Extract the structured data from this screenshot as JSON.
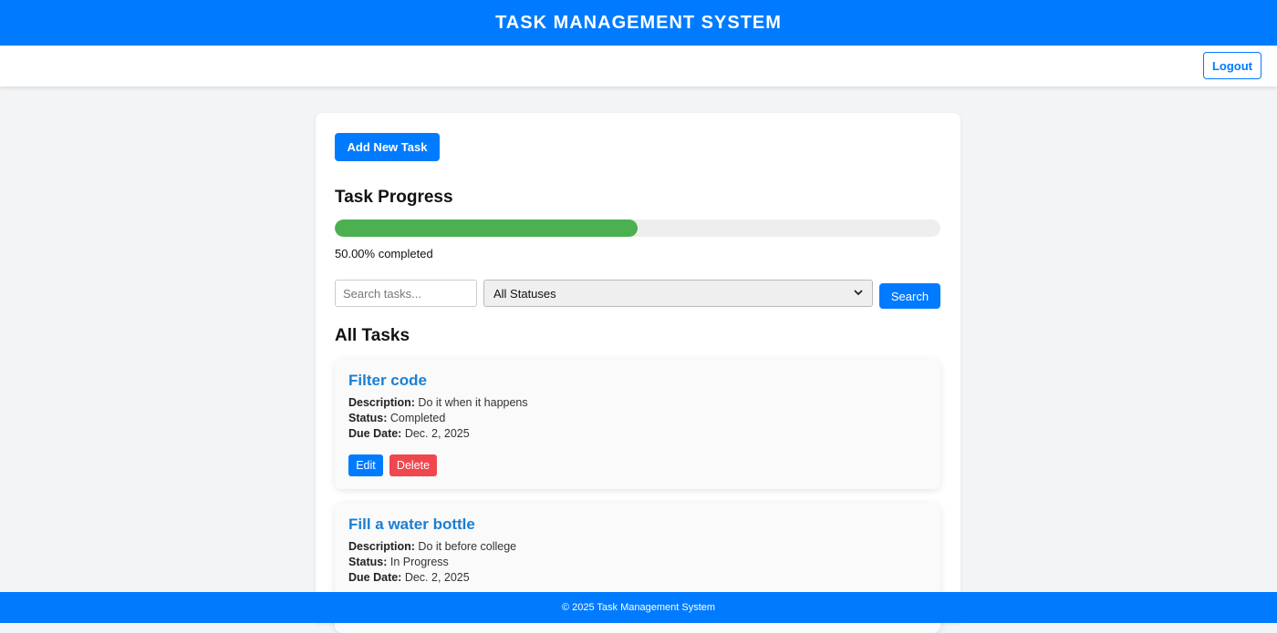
{
  "header": {
    "title": "TASK MANAGEMENT SYSTEM"
  },
  "nav": {
    "logout_label": "Logout"
  },
  "main": {
    "add_task_label": "Add New Task",
    "progress": {
      "title": "Task Progress",
      "fraction": 0.5,
      "text": "50.00% completed",
      "fill_color": "#4caf50"
    },
    "search": {
      "placeholder": "Search tasks...",
      "value": "",
      "status_selected": "All Statuses",
      "button_label": "Search"
    },
    "tasks_heading": "All Tasks",
    "tasks": [
      {
        "title": "Filter code",
        "description_label": "Description:",
        "description": "Do it when it happens",
        "status_label": "Status:",
        "status": "Completed",
        "due_label": "Due Date:",
        "due": "Dec. 2, 2025",
        "edit_label": "Edit",
        "delete_label": "Delete"
      },
      {
        "title": "Fill a water bottle",
        "description_label": "Description:",
        "description": "Do it before college",
        "status_label": "Status:",
        "status": "In Progress",
        "due_label": "Due Date:",
        "due": "Dec. 2, 2025"
      }
    ]
  },
  "footer": {
    "text": "© 2025 Task Management System"
  },
  "colors": {
    "primary": "#007bff",
    "danger": "#f0474e",
    "success": "#4caf50",
    "task_title": "#1a7fd4"
  },
  "icons": {
    "select_chevron": "chevron-down-icon"
  }
}
